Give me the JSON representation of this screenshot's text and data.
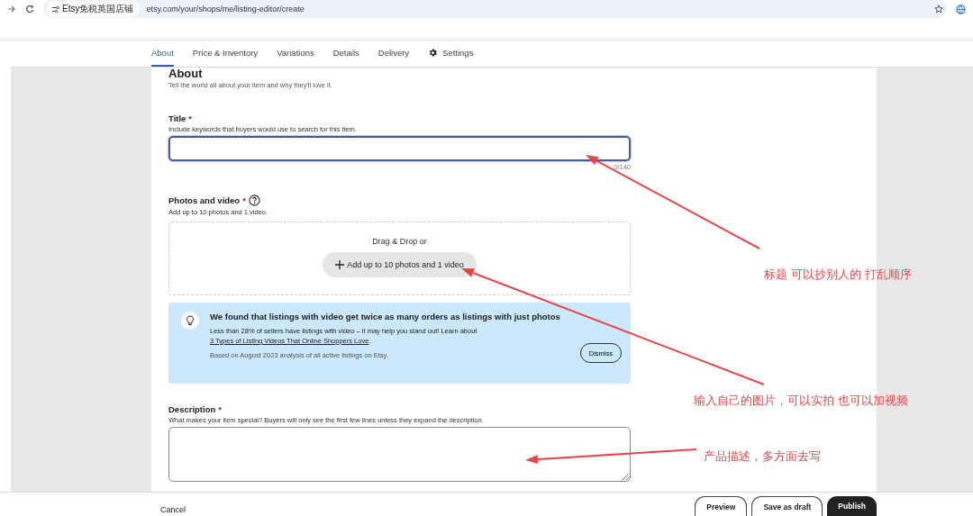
{
  "browser": {
    "site_chip": "Etsy免税英国店铺",
    "url": "etsy.com/your/shops/me/listing-editor/create"
  },
  "tabs": [
    {
      "label": "About",
      "selected": true,
      "kind": "text"
    },
    {
      "label": "Price & Inventory",
      "selected": false,
      "kind": "text"
    },
    {
      "label": "Variations",
      "selected": false,
      "kind": "text"
    },
    {
      "label": "Details",
      "selected": false,
      "kind": "text"
    },
    {
      "label": "Delivery",
      "selected": false,
      "kind": "text"
    },
    {
      "label": "Settings",
      "selected": false,
      "kind": "settings"
    }
  ],
  "section": {
    "heading": "About",
    "subtitle": "Tell the world all about your item and why they'll love it."
  },
  "title_field": {
    "label": "Title",
    "required_mark": "*",
    "hint": "Include keywords that buyers would use to search for this item.",
    "counter": "0/140",
    "focused": true
  },
  "photos": {
    "label": "Photos and video",
    "required_mark": "*",
    "hint": "Add up to 10 photos and 1 video.",
    "drop_text": "Drag & Drop or",
    "button": "Add up to 10 photos and 1 video"
  },
  "tip": {
    "title": "We found that listings with video get twice as many orders as listings with just photos",
    "text_before": "Less than 28% of sellers have listings with video – it may help you stand out! Learn about ",
    "link": "3 Types of Listing Videos That Online Shoppers Love",
    "text_after": ".",
    "note": "Based on August 2023 analysis of all active listings on Etsy.",
    "dismiss": "Dismiss"
  },
  "description": {
    "label": "Description",
    "required_mark": "*",
    "hint": "What makes your item special? Buyers will only see the first few lines unless they expand the description."
  },
  "footer": {
    "cancel": "Cancel",
    "buttons": [
      {
        "label": "Preview",
        "kind": "outline"
      },
      {
        "label": "Save as draft",
        "kind": "outline"
      },
      {
        "label": "Publish",
        "kind": "primary"
      }
    ]
  },
  "annotations": [
    {
      "text": "标题 可以抄别人的  打乱顺序"
    },
    {
      "text": "输入自己的图片，可以实拍 也可以加视频"
    },
    {
      "text": "产品描述，多方面去写"
    }
  ]
}
